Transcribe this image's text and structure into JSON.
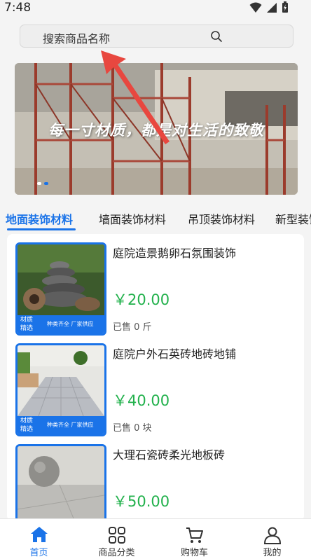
{
  "status": {
    "time": "7:48"
  },
  "search": {
    "placeholder": "搜索商品名称"
  },
  "banner": {
    "caption": "每一寸材质，都是对生活的致敬"
  },
  "categories": [
    {
      "label": "地面装饰材料",
      "active": true
    },
    {
      "label": "墙面装饰材料",
      "active": false
    },
    {
      "label": "吊顶装饰材料",
      "active": false
    },
    {
      "label": "新型装饰",
      "active": false
    }
  ],
  "products": [
    {
      "title": "庭院造景鹅卵石氛围装饰",
      "price": "￥20.00",
      "sold": "已售 0 斤",
      "tag_line1": "材质",
      "tag_line2": "精选",
      "slogan": "种类齐全 厂家供应"
    },
    {
      "title": "庭院户外石英砖地砖地铺",
      "price": "￥40.00",
      "sold": "已售 0 块",
      "tag_line1": "材质",
      "tag_line2": "精选",
      "slogan": "种类齐全 厂家供应"
    },
    {
      "title": "大理石瓷砖柔光地板砖",
      "price": "￥50.00",
      "sold": "",
      "tag_line1": "",
      "tag_line2": "",
      "slogan": ""
    }
  ],
  "nav": [
    {
      "label": "首页",
      "icon": "home-icon",
      "active": true
    },
    {
      "label": "商品分类",
      "icon": "category-grid-icon",
      "active": false
    },
    {
      "label": "购物车",
      "icon": "cart-icon",
      "active": false
    },
    {
      "label": "我的",
      "icon": "user-icon",
      "active": false
    }
  ],
  "colors": {
    "accent": "#1a73e8",
    "price": "#22b14c",
    "annotation_arrow": "#e8473f"
  }
}
